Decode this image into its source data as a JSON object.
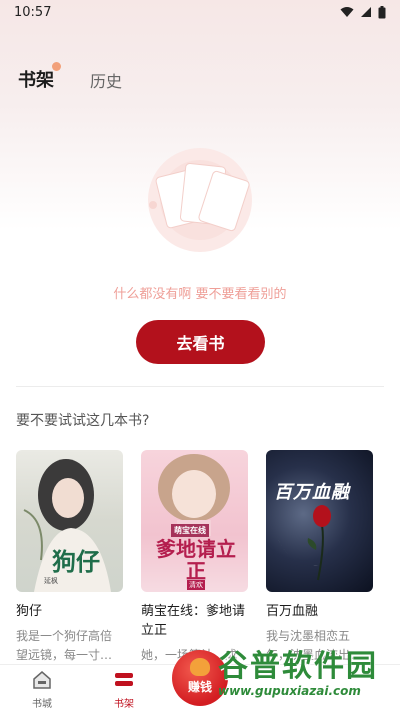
{
  "status": {
    "time": "10:57"
  },
  "tabs": {
    "active": "书架",
    "inactive": "历史"
  },
  "empty": {
    "message": "什么都没有啊 要不要看看别的"
  },
  "go_button": "去看书",
  "suggest": {
    "title": "要不要试试这几本书?"
  },
  "books": [
    {
      "title": "狗仔",
      "desc": "我是一个狗仔高倍望远镜，每一寸…",
      "cover_text": "狗仔",
      "cover_author": "延枫"
    },
    {
      "title": "萌宝在线：爹地请立正",
      "desc": "她，一场算计，成为全城的…",
      "cover_text": "爹地请立正",
      "cover_series": "萌宝在线",
      "cover_author": "清欢"
    },
    {
      "title": "百万血融",
      "desc": "我与沈墨相恋五年，沈墨血流出…",
      "cover_text": "百万血融"
    }
  ],
  "bottom_nav": {
    "store": "书城",
    "shelf": "书架",
    "earn": "赚钱"
  },
  "watermark": {
    "text": "谷普软件园",
    "url": "www.gupuxiazai.com"
  },
  "colors": {
    "accent": "#b3111c",
    "empty_text": "#ef9f98",
    "watermark": "#2e8b3a"
  }
}
